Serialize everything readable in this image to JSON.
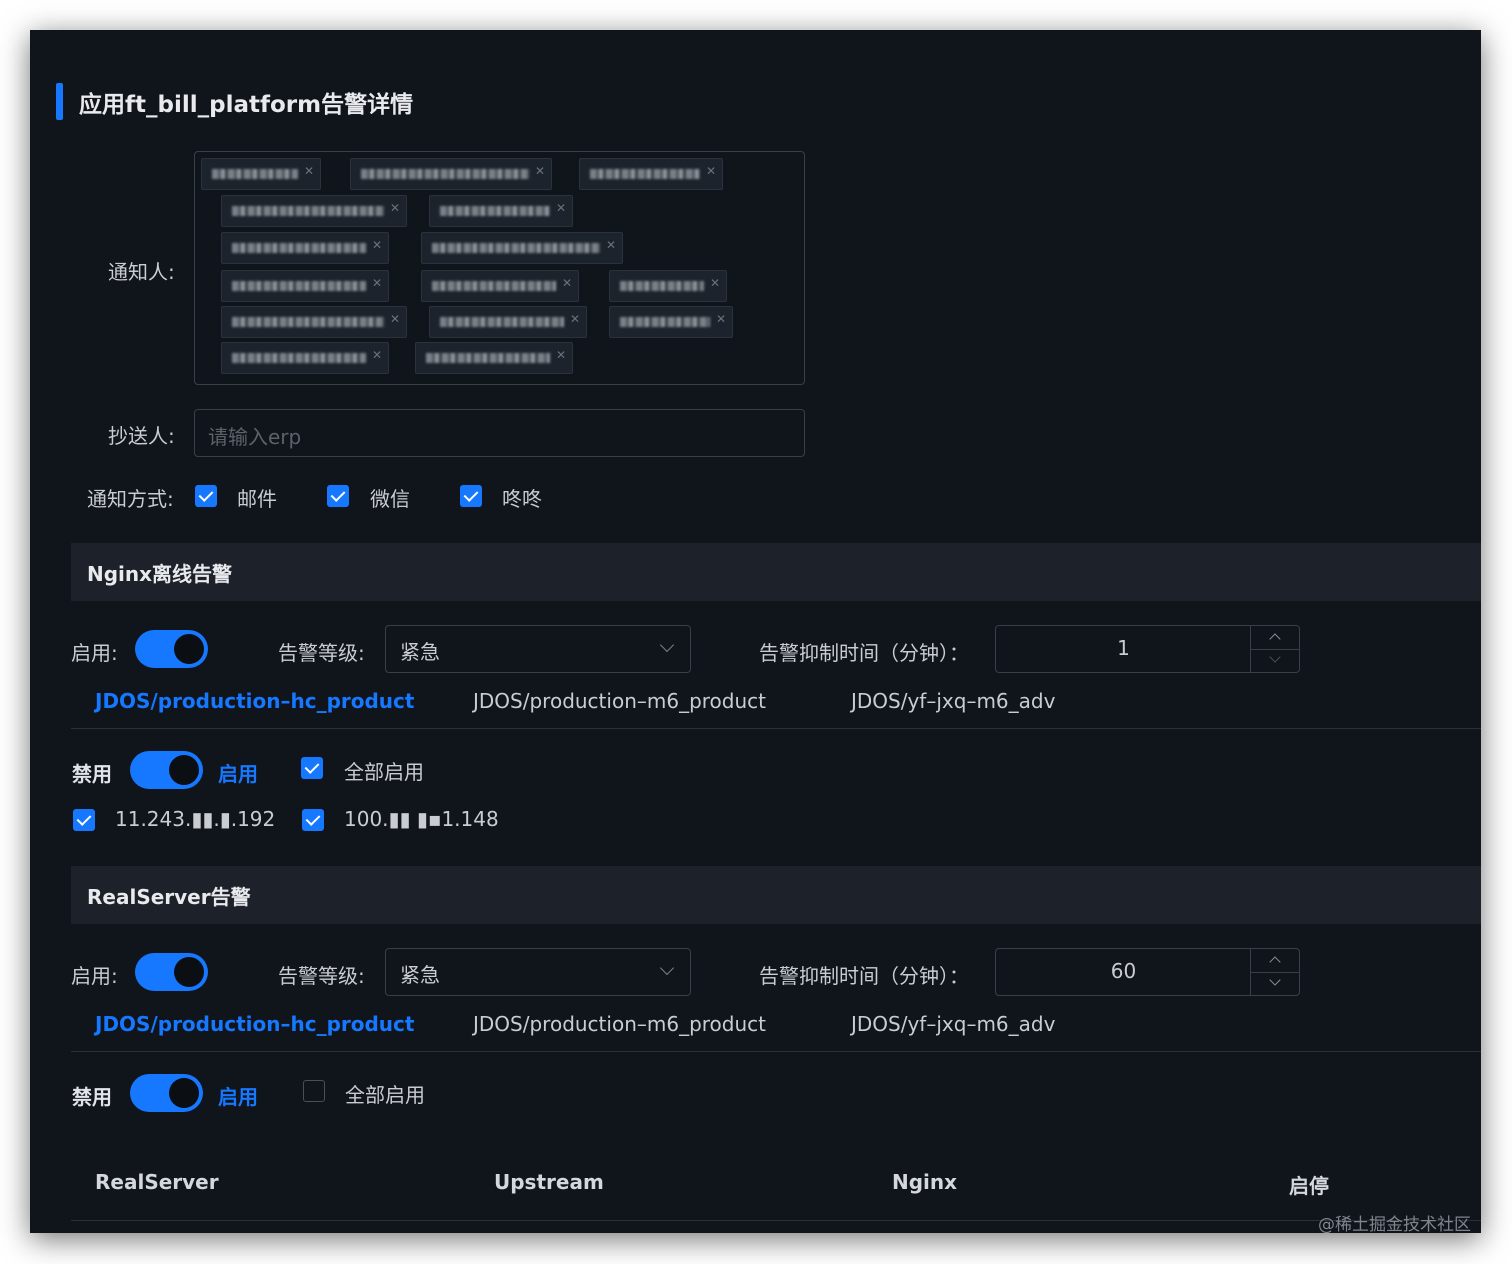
{
  "page": {
    "title": "应用ft_bill_platform告警详情",
    "accent_color": "#1677ff"
  },
  "recipients": {
    "label": "通知人:",
    "tag_count": 16
  },
  "cc": {
    "label": "抄送人:",
    "placeholder": "请输入erp"
  },
  "notify_method": {
    "label": "通知方式:",
    "options": [
      {
        "label": "邮件",
        "checked": true
      },
      {
        "label": "微信",
        "checked": true
      },
      {
        "label": "咚咚",
        "checked": true
      }
    ]
  },
  "nginx_section": {
    "title": "Nginx离线告警",
    "enable_label": "启用:",
    "enabled": true,
    "level_label": "告警等级:",
    "level_value": "紧急",
    "suppress_label": "告警抑制时间（分钟）：",
    "suppress_value": "1",
    "tabs": [
      {
        "label": "JDOS/production–hc_product",
        "active": true
      },
      {
        "label": "JDOS/production–m6_product",
        "active": false
      },
      {
        "label": "JDOS/yf–jxq–m6_adv",
        "active": false
      }
    ],
    "disable_label": "禁用",
    "on_label": "启用",
    "all_enable_label": "全部启用",
    "all_enabled": true,
    "hosts": [
      {
        "ip": "11.243.▮▮.▮.192",
        "checked": true
      },
      {
        "ip": "100.▮▮ ▮▪1.148",
        "checked": true
      }
    ]
  },
  "realserver_section": {
    "title": "RealServer告警",
    "enable_label": "启用:",
    "enabled": true,
    "level_label": "告警等级:",
    "level_value": "紧急",
    "suppress_label": "告警抑制时间（分钟）：",
    "suppress_value": "60",
    "tabs": [
      {
        "label": "JDOS/production–hc_product",
        "active": true
      },
      {
        "label": "JDOS/production–m6_product",
        "active": false
      },
      {
        "label": "JDOS/yf–jxq–m6_adv",
        "active": false
      }
    ],
    "disable_label": "禁用",
    "on_label": "启用",
    "all_enable_label": "全部启用",
    "all_enabled": false,
    "table_headers": [
      "RealServer",
      "Upstream",
      "Nginx",
      "启停"
    ]
  },
  "watermark": "@稀土掘金技术社区"
}
